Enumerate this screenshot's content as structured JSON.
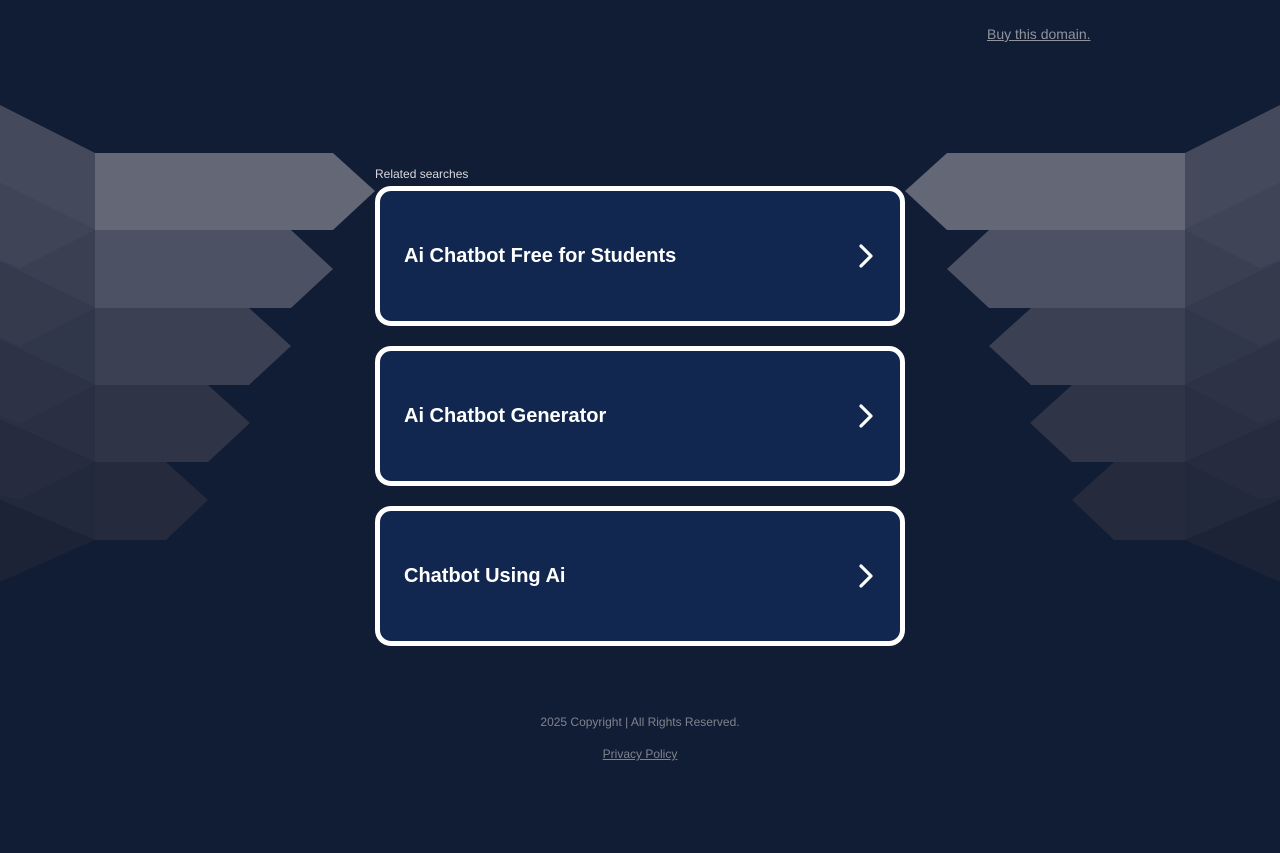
{
  "header": {
    "buy_domain_link": "Buy this domain."
  },
  "related": {
    "label": "Related searches",
    "items": [
      {
        "title": "Ai Chatbot Free for Students",
        "icon": "chevron-right-icon"
      },
      {
        "title": "Ai Chatbot Generator",
        "icon": "chevron-right-icon"
      },
      {
        "title": "Chatbot Using Ai",
        "icon": "chevron-right-icon"
      }
    ]
  },
  "footer": {
    "copyright": "2025 Copyright | All Rights Reserved.",
    "privacy_link": "Privacy Policy"
  },
  "colors": {
    "background": "#111c35",
    "card_background": "#122750",
    "card_border": "#ffffff",
    "link_text": "#8f949d"
  }
}
